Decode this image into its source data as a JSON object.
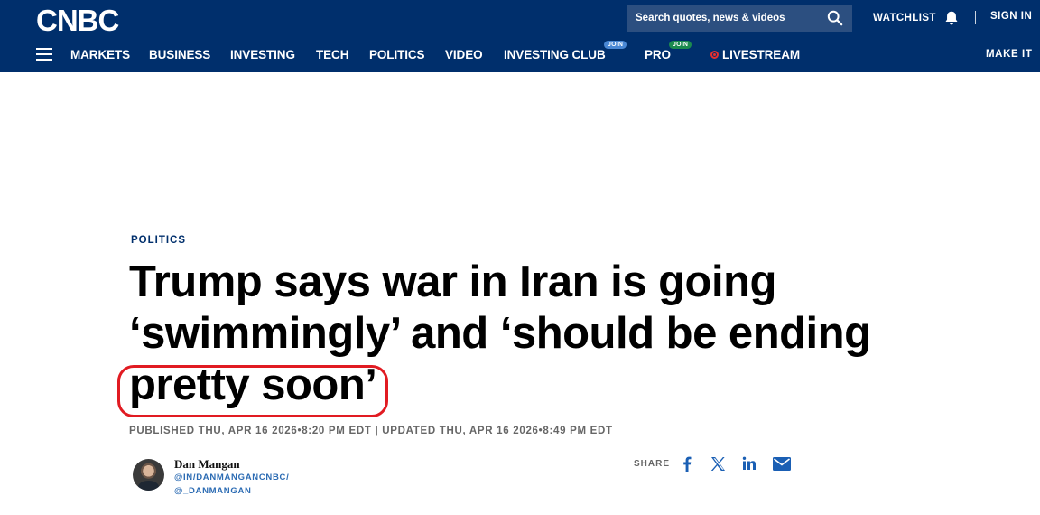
{
  "header": {
    "logo_text": "CNBC",
    "search_placeholder": "Search quotes, news & videos",
    "watchlist": "WATCHLIST",
    "signin": "SIGN IN",
    "make_it": "MAKE IT",
    "brand_color": "#002f6c"
  },
  "nav": {
    "items": [
      {
        "label": "MARKETS"
      },
      {
        "label": "BUSINESS"
      },
      {
        "label": "INVESTING"
      },
      {
        "label": "TECH"
      },
      {
        "label": "POLITICS"
      },
      {
        "label": "VIDEO"
      },
      {
        "label": "INVESTING CLUB",
        "badge": "JOIN"
      },
      {
        "label": "PRO",
        "badge": "JOIN"
      },
      {
        "label": "LIVESTREAM"
      }
    ]
  },
  "article": {
    "section": "POLITICS",
    "headline_part1": "Trump says war in Iran is going ‘swimmingly’ and ‘should be ending ",
    "headline_highlight": "pretty soon",
    "headline_part2": "’",
    "published": "PUBLISHED THU, APR 16 2026•8:20 PM EDT | UPDATED THU, APR 16 2026•8:49 PM EDT",
    "highlight_color": "#e11b22"
  },
  "author": {
    "name": "Dan Mangan",
    "handle1": "@IN/DANMANGANCNBC/",
    "handle2": "@_DANMANGAN"
  },
  "share": {
    "label": "SHARE",
    "icons": [
      "facebook-icon",
      "x-icon",
      "linkedin-icon",
      "email-icon"
    ]
  }
}
